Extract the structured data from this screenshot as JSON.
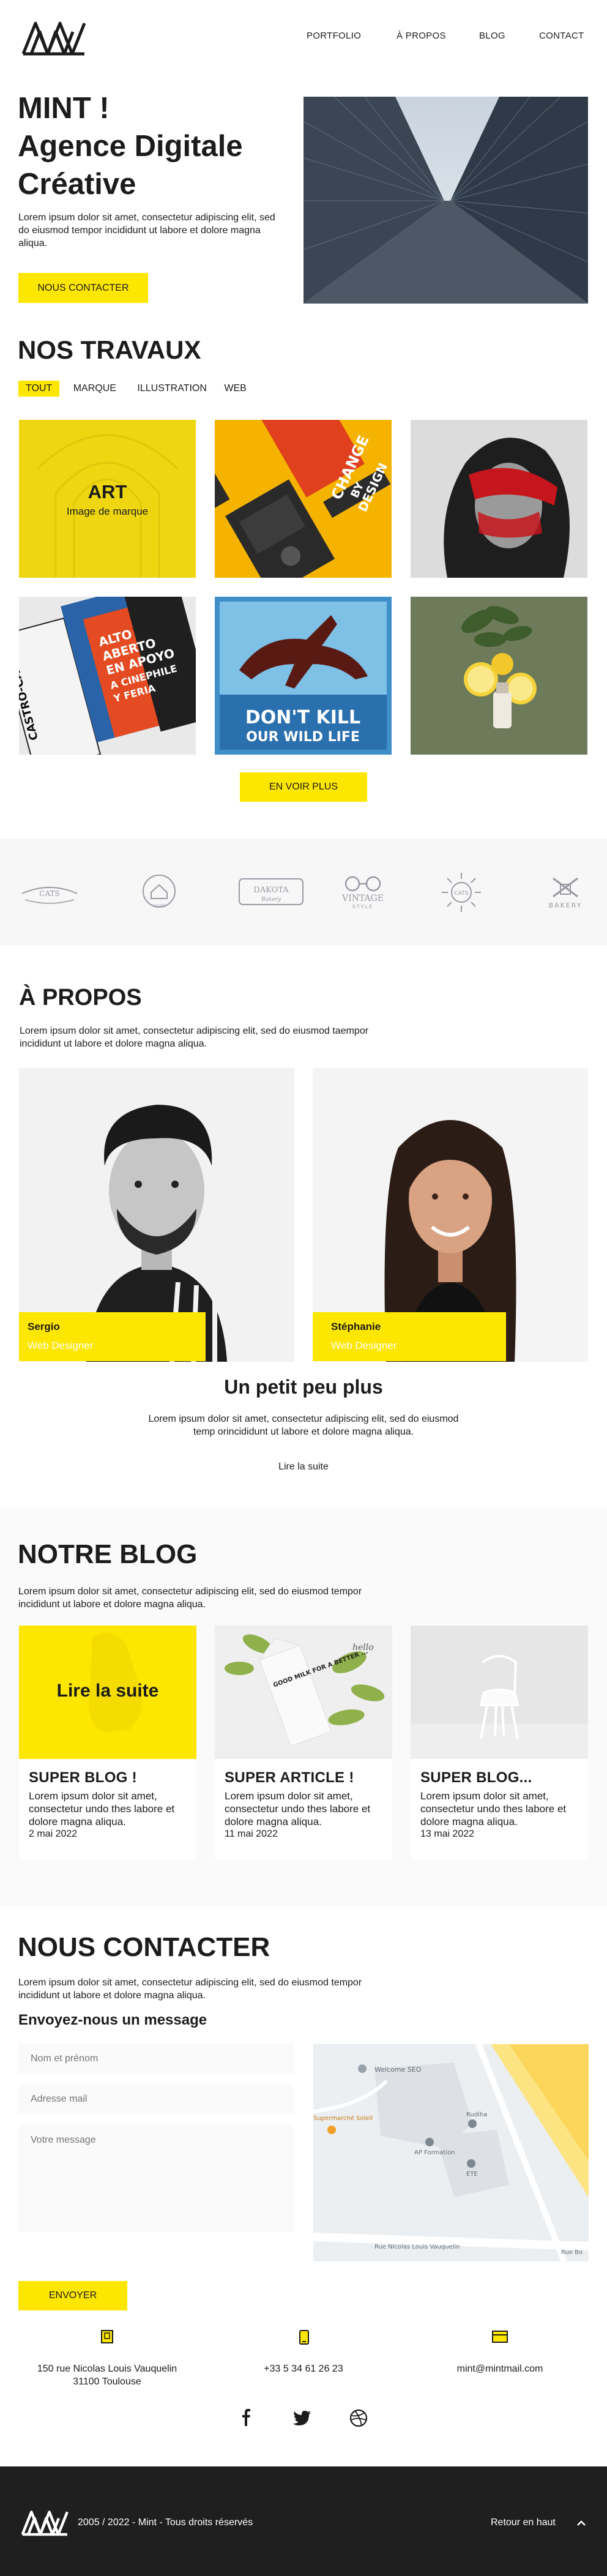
{
  "colors": {
    "accent": "#fde600",
    "dark": "#1f1f1f",
    "text": "#1c1c1c",
    "light_bg": "#fafafa"
  },
  "header": {
    "logo_icon": "mint-logo-icon",
    "nav": [
      "PORTFOLIO",
      "À PROPOS",
      "BLOG",
      "CONTACT"
    ]
  },
  "hero": {
    "title_line1": "MINT !",
    "title_line2": "Agence Digitale",
    "title_line3": "Créative",
    "text": "Lorem ipsum dolor sit amet, consectetur adipiscing elit, sed do eiusmod tempor incididunt ut labore et dolore magna aliqua.",
    "cta": "NOUS CONTACTER"
  },
  "portfolio": {
    "title": "NOS TRAVAUX",
    "filters": [
      "TOUT",
      "MARQUE",
      "ILLUSTRATION",
      "WEB"
    ],
    "active_filter": "TOUT",
    "overlay_title": "ART",
    "overlay_subtitle": "Image de marque",
    "poster_change_1": "CHANGE",
    "poster_change_2": "BY",
    "poster_change_3": "DESIGN",
    "book_1": "CASTRO-CAPITAL",
    "book_2": "ALTO",
    "book_3": "ABERTO",
    "book_4": "EN APOYO",
    "book_5": "A CINEPHILE",
    "book_6": "Y FERIA",
    "poster_wildlife_1": "DON'T KILL",
    "poster_wildlife_2": "OUR WILD LIFE",
    "more_button": "EN VOIR PLUS"
  },
  "partners": {
    "logos": [
      "CATS",
      "HOUSE",
      "DAKOTA",
      "VINTAGE",
      "CATS",
      "BAKERY"
    ],
    "sublines": [
      "",
      "",
      "Bakery",
      "STYLE",
      "",
      ""
    ]
  },
  "about": {
    "title": "À PROPOS",
    "text": "Lorem ipsum dolor sit amet, consectetur adipiscing elit, sed do eiusmod taempor incididunt ut labore et dolore magna aliqua.",
    "team": [
      {
        "name": "Sergio",
        "role": "Web Designer"
      },
      {
        "name": "Stéphanie",
        "role": "Web Designer"
      }
    ],
    "more_title": "Un petit peu plus",
    "more_text": "Lorem ipsum dolor sit amet, consectetur adipiscing elit, sed do eiusmod temp orincididunt ut labore et dolore magna aliqua.",
    "read_more": "Lire la suite"
  },
  "blog": {
    "title": "NOTRE BLOG",
    "text": "Lorem ipsum dolor sit amet, consectetur adipiscing elit, sed do eiusmod tempor incididunt ut labore et dolore magna aliqua.",
    "overlay": "Lire la suite",
    "carton_text": "GOOD MILK FOR A BETTER ...",
    "carton_brand": "hello",
    "posts": [
      {
        "title": "SUPER BLOG !",
        "text": "Lorem ipsum dolor sit amet, consectetur undo thes labore et dolore magna aliqua.",
        "date": "2 mai 2022"
      },
      {
        "title": "SUPER ARTICLE !",
        "text": "Lorem ipsum dolor sit amet, consectetur undo thes labore et dolore magna aliqua.",
        "date": "11 mai 2022"
      },
      {
        "title": "SUPER BLOG...",
        "text": "Lorem ipsum dolor sit amet, consectetur undo thes labore et dolore magna aliqua.",
        "date": "13 mai 2022"
      }
    ]
  },
  "contact": {
    "title": "NOUS CONTACTER",
    "text": "Lorem ipsum dolor sit amet, consectetur adipiscing elit, sed do eiusmod tempor incididunt ut labore et dolore magna aliqua.",
    "form_title": "Envoyez-nous un message",
    "name_placeholder": "Nom et prénom",
    "email_placeholder": "Adresse mail",
    "message_placeholder": "Votre message",
    "submit": "ENVOYER",
    "map_labels": [
      "Welcome SEO",
      "Supermarché Soleil",
      "Rudiha",
      "AP Formation",
      "ETE",
      "Rue Nicolas Louis Vauquelin",
      "Rue Bo"
    ],
    "address_line1": "150 rue Nicolas Louis Vauquelin",
    "address_line2": "31100 Toulouse",
    "phone": "+33 5 34 61 26 23",
    "email": "mint@mintmail.com",
    "social": [
      "facebook-icon",
      "twitter-icon",
      "dribbble-icon"
    ]
  },
  "footer": {
    "copyright": "2005 / 2022 - Mint - Tous droits réservés",
    "back_to_top": "Retour en haut"
  }
}
